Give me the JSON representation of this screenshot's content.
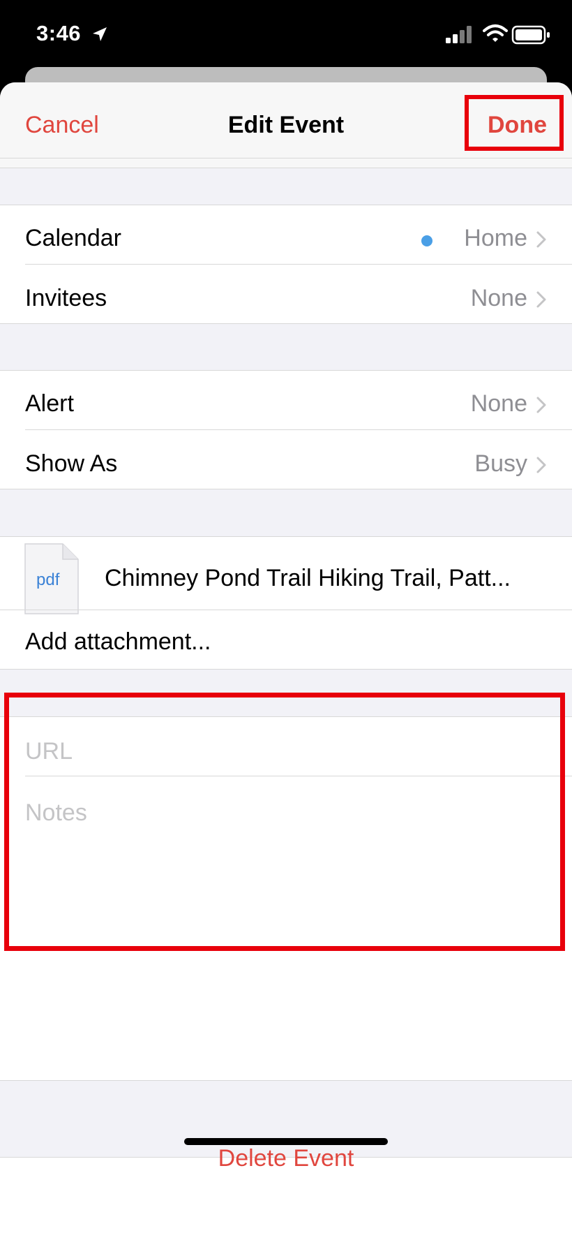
{
  "status_bar": {
    "time": "3:46",
    "icons": [
      "location-icon",
      "signal-icon",
      "wifi-icon",
      "battery-icon"
    ]
  },
  "nav": {
    "cancel_label": "Cancel",
    "title": "Edit Event",
    "done_label": "Done"
  },
  "group1": {
    "calendar": {
      "label": "Calendar",
      "value": "Home",
      "dot_color": "#4a9fe6"
    },
    "invitees": {
      "label": "Invitees",
      "value": "None"
    }
  },
  "group2": {
    "alert": {
      "label": "Alert",
      "value": "None"
    },
    "show_as": {
      "label": "Show As",
      "value": "Busy"
    }
  },
  "attachments": {
    "file_type": "pdf",
    "file_name": "Chimney Pond Trail Hiking Trail, Patt...",
    "add_label": "Add attachment..."
  },
  "details": {
    "url_placeholder": "URL",
    "notes_placeholder": "Notes"
  },
  "footer": {
    "delete_label": "Delete Event"
  },
  "colors": {
    "accent": "#e0463e",
    "highlight": "#e8000b",
    "secondary_text": "#8e8e93",
    "placeholder": "#c4c4c6"
  }
}
